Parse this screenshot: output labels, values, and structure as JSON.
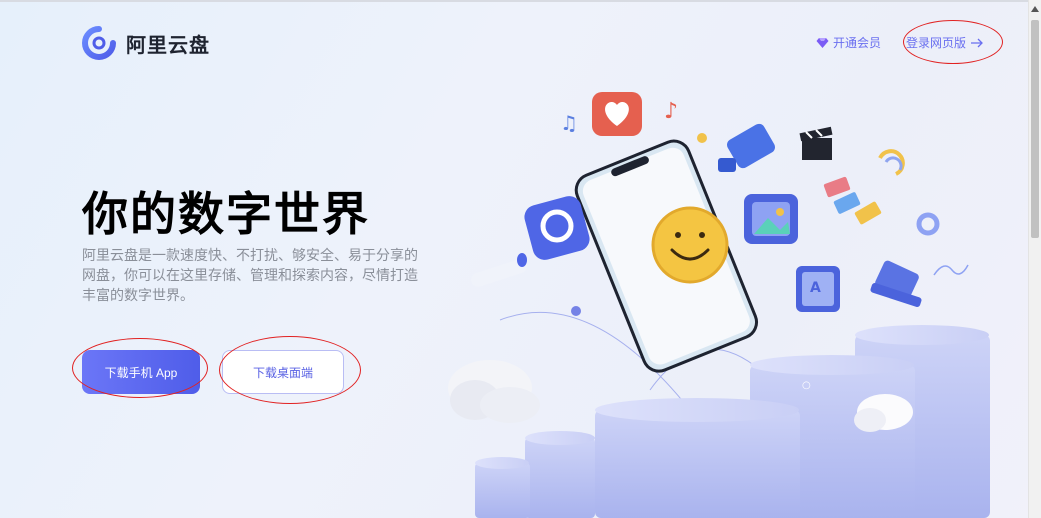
{
  "brand": {
    "name": "阿里云盘",
    "logo_icon": "aliyun-drive-logo-icon",
    "accent": "#5b63ef"
  },
  "nav": {
    "vip_label": "开通会员",
    "vip_icon": "diamond-icon",
    "login_label": "登录网页版",
    "login_icon": "arrow-right-icon"
  },
  "hero": {
    "title": "你的数字世界",
    "description": "阿里云盘是一款速度快、不打扰、够安全、易于分享的网盘，你可以在这里存储、管理和探索内容，尽情打造丰富的数字世界。",
    "app_button": "下载手机 App",
    "desktop_button": "下载桌面端"
  },
  "colors": {
    "primary_button": "#5a66ef",
    "text_dark": "#000000",
    "text_muted": "#8a8f99",
    "annotation": "#e12222"
  }
}
